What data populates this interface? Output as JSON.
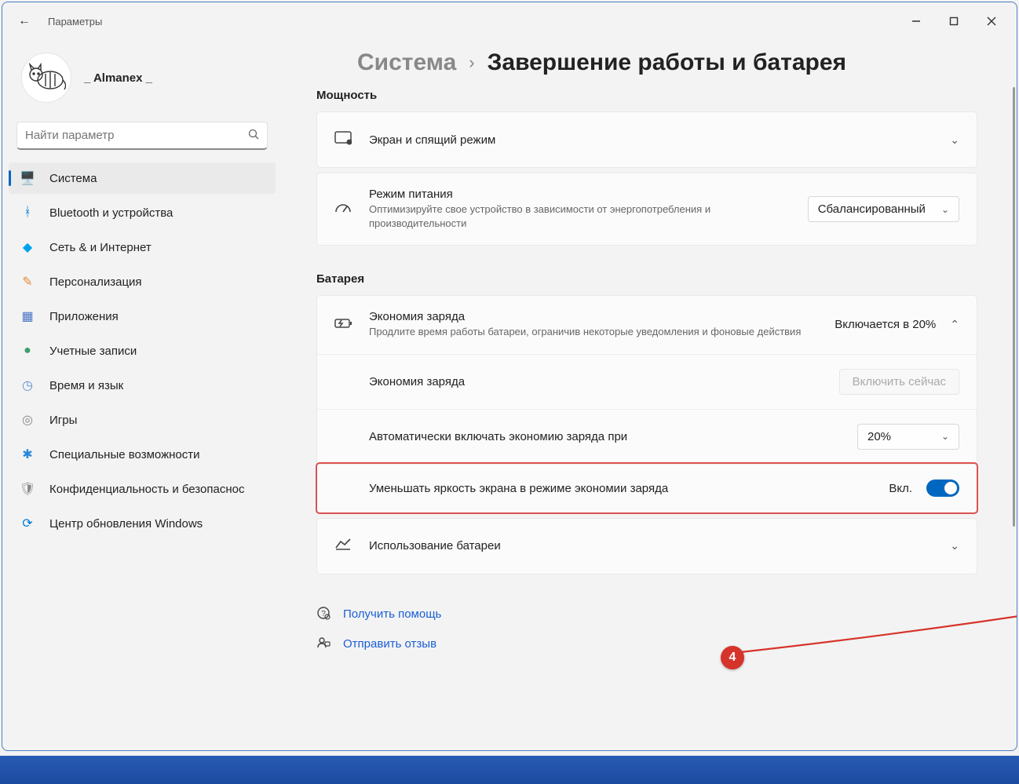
{
  "window": {
    "app_title": "Параметры",
    "username": "_ Almanex _"
  },
  "search": {
    "placeholder": "Найти параметр"
  },
  "nav": {
    "items": [
      {
        "label": "Система",
        "icon": "🖥️",
        "color": "#0078d4",
        "active": true
      },
      {
        "label": "Bluetooth и устройства",
        "icon": "ᚼ",
        "color": "#0078d4"
      },
      {
        "label": "Сеть & и Интернет",
        "icon": "◆",
        "color": "#00a2ed"
      },
      {
        "label": "Персонализация",
        "icon": "✎",
        "color": "#e38b3f"
      },
      {
        "label": "Приложения",
        "icon": "▦",
        "color": "#4a74c5"
      },
      {
        "label": "Учетные записи",
        "icon": "●",
        "color": "#3aa06a"
      },
      {
        "label": "Время и язык",
        "icon": "◷",
        "color": "#5b8bd0"
      },
      {
        "label": "Игры",
        "icon": "◎",
        "color": "#888"
      },
      {
        "label": "Специальные возможности",
        "icon": "✱",
        "color": "#2b88d8"
      },
      {
        "label": "Конфиденциальность и безопаснос",
        "icon": "🛡",
        "color": "#888"
      },
      {
        "label": "Центр обновления Windows",
        "icon": "⟳",
        "color": "#0078d4"
      }
    ]
  },
  "breadcrumb": {
    "parent": "Система",
    "current": "Завершение работы и батарея"
  },
  "sections": {
    "power_label": "Мощность",
    "screen_sleep": {
      "title": "Экран и спящий режим"
    },
    "power_mode": {
      "title": "Режим питания",
      "desc": "Оптимизируйте свое устройство в зависимости от энергопотребления и производительности",
      "value": "Сбалансированный"
    },
    "battery_label": "Батарея",
    "batt_saver": {
      "title": "Экономия заряда",
      "desc": "Продлите время работы батареи, ограничив некоторые уведомления и фоновые действия",
      "status": "Включается в 20%",
      "sub_econ_label": "Экономия заряда",
      "sub_econ_btn": "Включить сейчас",
      "sub_auto_label": "Автоматически включать экономию заряда при",
      "sub_auto_value": "20%",
      "sub_bright_label": "Уменьшать яркость экрана в режиме экономии заряда",
      "sub_bright_state": "Вкл."
    },
    "usage": {
      "title": "Использование батареи"
    }
  },
  "help": {
    "get_help": "Получить помощь",
    "feedback": "Отправить отзыв"
  },
  "callout": {
    "number": "4"
  }
}
